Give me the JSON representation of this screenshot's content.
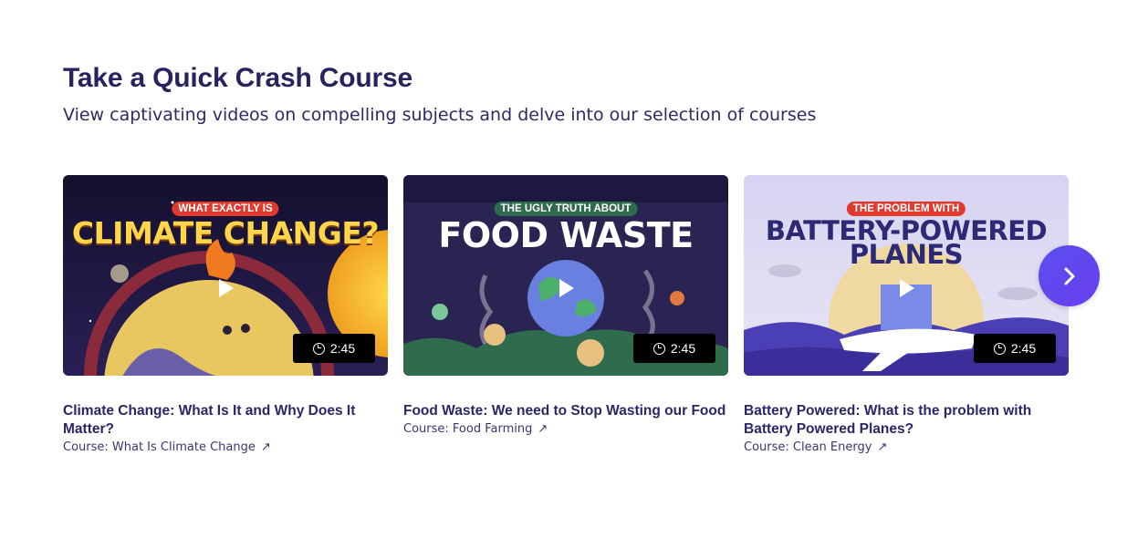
{
  "section": {
    "title": "Take a Quick Crash Course",
    "subtitle": "View captivating videos on compelling subjects and delve into our selection of courses"
  },
  "cards": [
    {
      "badge": "What Exactly Is",
      "headline": "CLIMATE CHANGE?",
      "duration": "2:45",
      "title": "Climate Change: What Is It and Why Does It Matter?",
      "course": "Course: What Is Climate Change",
      "colors": {
        "badge": "#e03a2f",
        "bg": "#1e1740"
      }
    },
    {
      "badge": "The Ugly Truth About",
      "headline": "FOOD WASTE",
      "duration": "2:45",
      "title": "Food Waste: We need to Stop Wasting our Food",
      "course": "Course: Food Farming",
      "colors": {
        "badge": "#2f6b4d",
        "bg": "#2a2452"
      }
    },
    {
      "badge": "The Problem With",
      "headline_line1": "BATTERY-POWERED",
      "headline_line2": "PLANES",
      "duration": "2:45",
      "title": "Battery Powered: What is the problem with Battery Powered Planes?",
      "course": "Course: Clean Energy",
      "colors": {
        "badge": "#e03a2f",
        "bg": "#d9d7f0"
      }
    }
  ],
  "icons": {
    "play": "play-icon",
    "clock": "clock-icon",
    "external": "arrow-up-right-icon",
    "next": "chevron-right-icon"
  },
  "colors": {
    "heading": "#27235f",
    "accent": "#5a50ee"
  }
}
